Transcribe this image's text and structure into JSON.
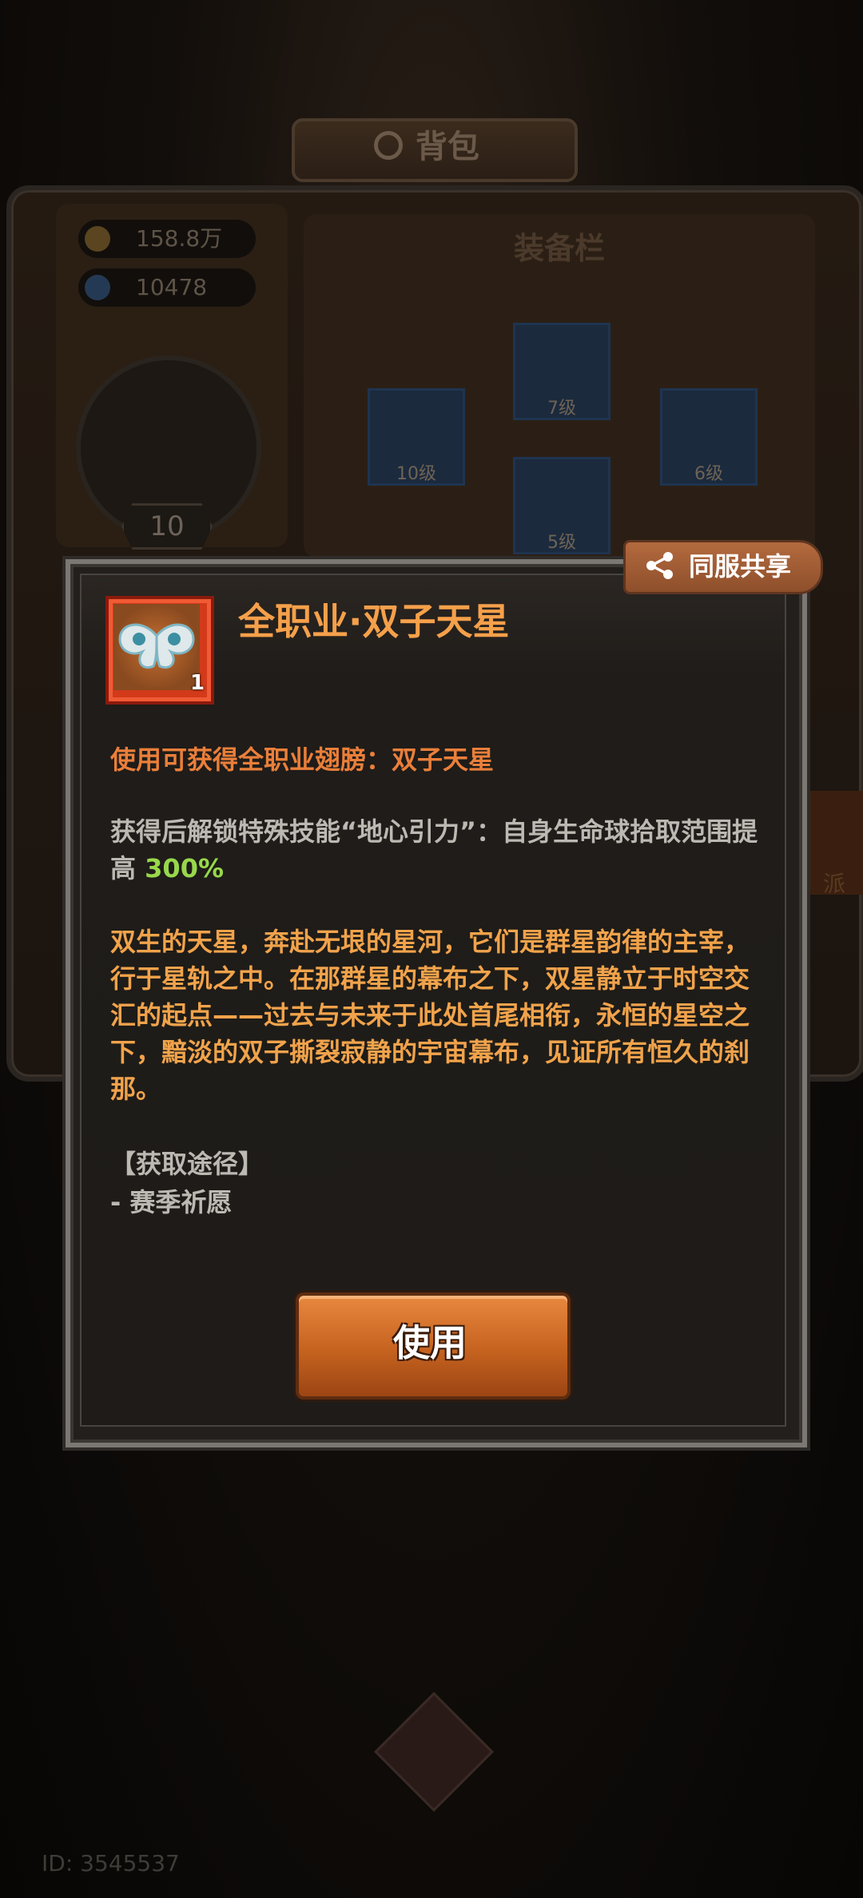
{
  "background": {
    "bag_title": "背包",
    "currencies": [
      {
        "icon": "gold-coin-icon",
        "value": "158.8万",
        "color": "#c9902b"
      },
      {
        "icon": "diamond-icon",
        "value": "10478",
        "color": "#3a8bd8"
      }
    ],
    "player_level": "10",
    "equipment_title": "装备栏",
    "slots": [
      {
        "label": "7级"
      },
      {
        "label": "10级"
      },
      {
        "label": "6级"
      },
      {
        "label": "5级"
      }
    ],
    "right_tab_label": "派",
    "footer_id": "ID: 3545537"
  },
  "dialog": {
    "share_button": "同服共享",
    "item": {
      "title": "全职业·双子天星",
      "count": "1",
      "icon": "twin-star-wings-icon"
    },
    "obtain_text": "使用可获得全职业翅膀：双子天星",
    "skill_text": "获得后解锁特殊技能“地心引力”：自身生命球拾取范围提高",
    "skill_value": "300%",
    "lore_text": "双生的天星，奔赴无垠的星河，它们是群星韵律的主宰，行于星轨之中。在那群星的幕布之下，双星静立于时空交汇的起点——过去与未来于此处首尾相衔，永恒的星空之下，黯淡的双子撕裂寂静的宇宙幕布，见证所有恒久的刹那。",
    "source_title": "【获取途径】",
    "source_item": "- 赛季祈愿",
    "use_button": "使用"
  },
  "colors": {
    "title_orange": "#f5a04a",
    "highlight_green": "#98d84b",
    "lore_gold": "#f1a34b",
    "obtain_orange": "#ea7f3a"
  }
}
